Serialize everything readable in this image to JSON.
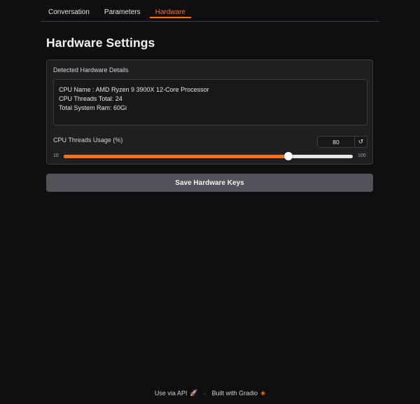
{
  "tabs": [
    {
      "label": "Conversation"
    },
    {
      "label": "Parameters"
    },
    {
      "label": "Hardware"
    }
  ],
  "page_title": "Hardware Settings",
  "details": {
    "label": "Detected Hardware Details",
    "lines": [
      "CPU Name : AMD Ryzen 9 3900X 12-Core Processor",
      "CPU Threads Total: 24",
      "Total System Ram: 60Gi"
    ]
  },
  "cpu_slider": {
    "label": "CPU Threads Usage (%)",
    "value": "80",
    "min": "10",
    "max": "100",
    "reset_icon": "reset-icon"
  },
  "save_button": "Save Hardware Keys",
  "footer": {
    "api_label": "Use via API",
    "separator": "·",
    "built_label": "Built with Gradio"
  },
  "colors": {
    "accent": "#f97316",
    "background": "#0f0f11",
    "panel": "#1f1f22",
    "button": "#52525b"
  }
}
